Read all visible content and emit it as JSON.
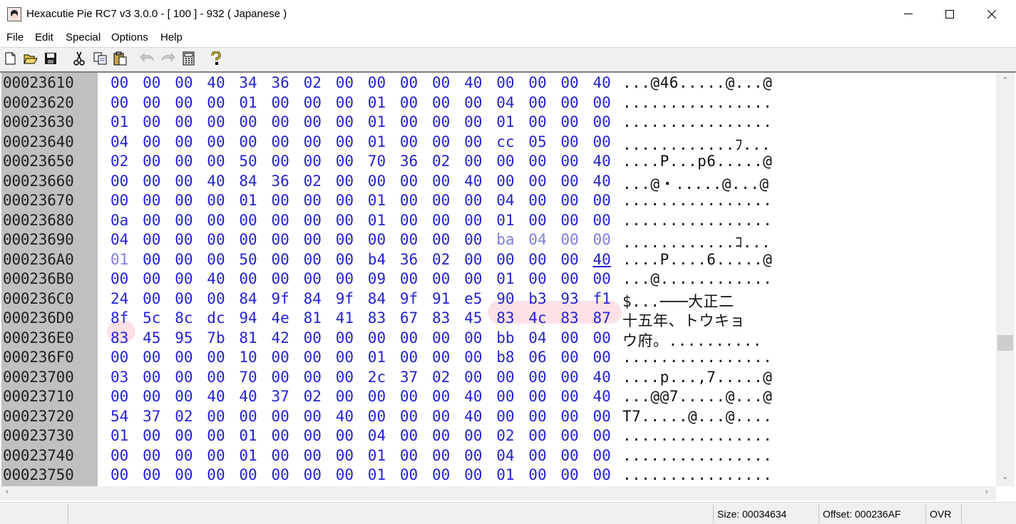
{
  "window": {
    "title": "Hexacutie Pie RC7 v3 3.0.0 - [ 100 ] - 932 ( Japanese )",
    "controls": {
      "minimize": "─",
      "maximize": "☐",
      "close": "✕"
    }
  },
  "menu": [
    "File",
    "Edit",
    "Special",
    "Options",
    "Help"
  ],
  "toolbar": {
    "icons": [
      "new-file-icon",
      "open-folder-icon",
      "save-icon",
      "cut-icon",
      "copy-icon",
      "paste-icon",
      "undo-icon",
      "redo-icon",
      "calculator-icon",
      "help-icon"
    ],
    "glyphs": [
      "🗋",
      "📂",
      "💾",
      "✂",
      "⧉",
      "📋",
      "↶",
      "↷",
      "▦",
      "?"
    ]
  },
  "hex": {
    "rows": [
      {
        "addr": "00023610",
        "bytes": [
          "00",
          "00",
          "00",
          "40",
          "34",
          "36",
          "02",
          "00",
          "00",
          "00",
          "00",
          "40",
          "00",
          "00",
          "00",
          "40"
        ],
        "ascii": "...@46.....@...@"
      },
      {
        "addr": "00023620",
        "bytes": [
          "00",
          "00",
          "00",
          "00",
          "01",
          "00",
          "00",
          "00",
          "01",
          "00",
          "00",
          "00",
          "04",
          "00",
          "00",
          "00"
        ],
        "ascii": "................"
      },
      {
        "addr": "00023630",
        "bytes": [
          "01",
          "00",
          "00",
          "00",
          "00",
          "00",
          "00",
          "00",
          "01",
          "00",
          "00",
          "00",
          "01",
          "00",
          "00",
          "00"
        ],
        "ascii": "................"
      },
      {
        "addr": "00023640",
        "bytes": [
          "04",
          "00",
          "00",
          "00",
          "00",
          "00",
          "00",
          "00",
          "01",
          "00",
          "00",
          "00",
          "cc",
          "05",
          "00",
          "00"
        ],
        "ascii": "............ﾌ..."
      },
      {
        "addr": "00023650",
        "bytes": [
          "02",
          "00",
          "00",
          "00",
          "50",
          "00",
          "00",
          "00",
          "70",
          "36",
          "02",
          "00",
          "00",
          "00",
          "00",
          "40"
        ],
        "ascii": "....P...p6.....@"
      },
      {
        "addr": "00023660",
        "bytes": [
          "00",
          "00",
          "00",
          "40",
          "84",
          "36",
          "02",
          "00",
          "00",
          "00",
          "00",
          "40",
          "00",
          "00",
          "00",
          "40"
        ],
        "ascii": "...@・.....@...@"
      },
      {
        "addr": "00023670",
        "bytes": [
          "00",
          "00",
          "00",
          "00",
          "01",
          "00",
          "00",
          "00",
          "01",
          "00",
          "00",
          "00",
          "04",
          "00",
          "00",
          "00"
        ],
        "ascii": "................"
      },
      {
        "addr": "00023680",
        "bytes": [
          "0a",
          "00",
          "00",
          "00",
          "00",
          "00",
          "00",
          "00",
          "01",
          "00",
          "00",
          "00",
          "01",
          "00",
          "00",
          "00"
        ],
        "ascii": "................"
      },
      {
        "addr": "00023690",
        "bytes": [
          "04",
          "00",
          "00",
          "00",
          "00",
          "00",
          "00",
          "00",
          "00",
          "00",
          "00",
          "00",
          "ba",
          "04",
          "00",
          "00"
        ],
        "ascii": "............ｺ..."
      },
      {
        "addr": "000236A0",
        "bytes": [
          "01",
          "00",
          "00",
          "00",
          "50",
          "00",
          "00",
          "00",
          "b4",
          "36",
          "02",
          "00",
          "00",
          "00",
          "00",
          "40"
        ],
        "ascii": "....P....6.....@"
      },
      {
        "addr": "000236B0",
        "bytes": [
          "00",
          "00",
          "00",
          "40",
          "00",
          "00",
          "00",
          "00",
          "09",
          "00",
          "00",
          "00",
          "01",
          "00",
          "00",
          "00"
        ],
        "ascii": "...@............"
      },
      {
        "addr": "000236C0",
        "bytes": [
          "24",
          "00",
          "00",
          "00",
          "84",
          "9f",
          "84",
          "9f",
          "84",
          "9f",
          "91",
          "e5",
          "90",
          "b3",
          "93",
          "f1"
        ],
        "ascii": "$...───大正二"
      },
      {
        "addr": "000236D0",
        "bytes": [
          "8f",
          "5c",
          "8c",
          "dc",
          "94",
          "4e",
          "81",
          "41",
          "83",
          "67",
          "83",
          "45",
          "83",
          "4c",
          "83",
          "87"
        ],
        "ascii": "十五年、トウキョ"
      },
      {
        "addr": "000236E0",
        "bytes": [
          "83",
          "45",
          "95",
          "7b",
          "81",
          "42",
          "00",
          "00",
          "00",
          "00",
          "00",
          "00",
          "bb",
          "04",
          "00",
          "00"
        ],
        "ascii": "ウ府。.........."
      },
      {
        "addr": "000236F0",
        "bytes": [
          "00",
          "00",
          "00",
          "00",
          "10",
          "00",
          "00",
          "00",
          "01",
          "00",
          "00",
          "00",
          "b8",
          "06",
          "00",
          "00"
        ],
        "ascii": "................"
      },
      {
        "addr": "00023700",
        "bytes": [
          "03",
          "00",
          "00",
          "00",
          "70",
          "00",
          "00",
          "00",
          "2c",
          "37",
          "02",
          "00",
          "00",
          "00",
          "00",
          "40"
        ],
        "ascii": "....p...,7.....@"
      },
      {
        "addr": "00023710",
        "bytes": [
          "00",
          "00",
          "00",
          "40",
          "40",
          "37",
          "02",
          "00",
          "00",
          "00",
          "00",
          "40",
          "00",
          "00",
          "00",
          "40"
        ],
        "ascii": "...@@7.....@...@"
      },
      {
        "addr": "00023720",
        "bytes": [
          "54",
          "37",
          "02",
          "00",
          "00",
          "00",
          "00",
          "40",
          "00",
          "00",
          "00",
          "40",
          "00",
          "00",
          "00",
          "00"
        ],
        "ascii": "T7.....@...@...."
      },
      {
        "addr": "00023730",
        "bytes": [
          "01",
          "00",
          "00",
          "00",
          "01",
          "00",
          "00",
          "00",
          "04",
          "00",
          "00",
          "00",
          "02",
          "00",
          "00",
          "00"
        ],
        "ascii": "................"
      },
      {
        "addr": "00023740",
        "bytes": [
          "00",
          "00",
          "00",
          "00",
          "01",
          "00",
          "00",
          "00",
          "01",
          "00",
          "00",
          "00",
          "04",
          "00",
          "00",
          "00"
        ],
        "ascii": "................"
      },
      {
        "addr": "00023750",
        "bytes": [
          "00",
          "00",
          "00",
          "00",
          "00",
          "00",
          "00",
          "00",
          "01",
          "00",
          "00",
          "00",
          "01",
          "00",
          "00",
          "00"
        ],
        "ascii": "................"
      }
    ]
  },
  "status": {
    "size": "Size: 00034634",
    "offset": "Offset: 000236AF",
    "mode": "OVR"
  }
}
